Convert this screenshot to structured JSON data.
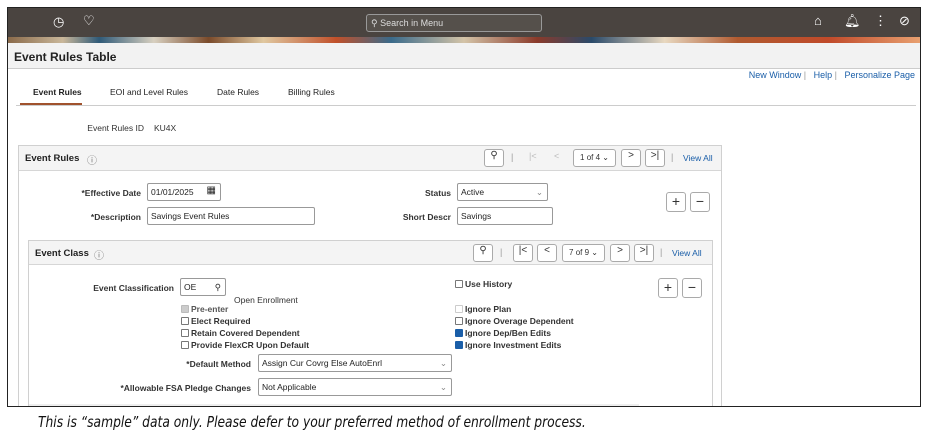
{
  "header": {
    "search_placeholder": "Search in Menu",
    "icons": [
      "history-icon",
      "favorites-icon",
      "home-icon",
      "notifications-icon",
      "actions-icon",
      "navigator-icon"
    ]
  },
  "page_title": "Event Rules Table",
  "links": {
    "new_window": "New Window",
    "help": "Help",
    "personalize": "Personalize Page"
  },
  "tabs": [
    {
      "label": "Event Rules",
      "active": true
    },
    {
      "label": "EOI and Level Rules"
    },
    {
      "label": "Date Rules"
    },
    {
      "label": "Billing Rules"
    }
  ],
  "event_rules_id": {
    "label": "Event Rules ID",
    "value": "KU4X"
  },
  "event_rules": {
    "title": "Event Rules",
    "pager": "1 of 4",
    "view_all": "View All",
    "effective_date_label": "*Effective Date",
    "effective_date": "01/01/2025",
    "description_label": "*Description",
    "description": "Savings Event Rules",
    "status_label": "Status",
    "status": "Active",
    "short_descr_label": "Short Descr",
    "short_descr": "Savings"
  },
  "event_class": {
    "title": "Event Class",
    "pager": "7 of 9",
    "view_all": "View All",
    "classification_label": "Event Classification",
    "classification": "OE",
    "classification_desc": "Open Enrollment",
    "use_history": "Use History",
    "left_checks": [
      {
        "label": "Pre-enter",
        "state": "disabled-checked"
      },
      {
        "label": "Elect Required",
        "state": "unchecked"
      },
      {
        "label": "Retain Covered Dependent",
        "state": "unchecked"
      },
      {
        "label": "Provide FlexCR Upon Default",
        "state": "unchecked"
      }
    ],
    "right_checks": [
      {
        "label": "Ignore Plan",
        "state": "disabled"
      },
      {
        "label": "Ignore Overage Dependent",
        "state": "unchecked"
      },
      {
        "label": "Ignore Dep/Ben Edits",
        "state": "checked"
      },
      {
        "label": "Ignore Investment Edits",
        "state": "checked"
      }
    ],
    "default_method_label": "*Default Method",
    "default_method": "Assign Cur Covrg Else AutoEnrl",
    "fsa_label": "*Allowable FSA Pledge Changes",
    "fsa": "Not Applicable"
  },
  "caption": "This is “sample” data only. Please defer to your preferred method of enrollment process."
}
